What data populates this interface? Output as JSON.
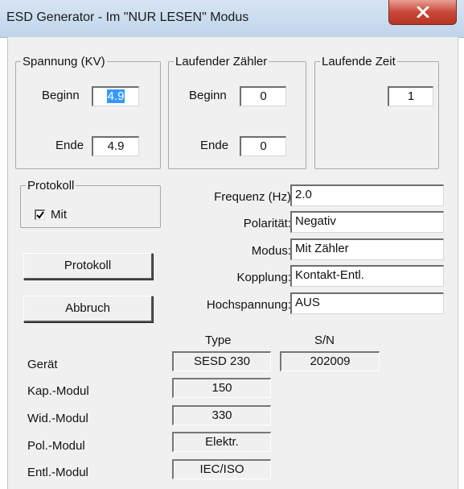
{
  "window": {
    "title": "ESD Generator - Im \"NUR LESEN\" Modus"
  },
  "spannung": {
    "legend": "Spannung (KV)",
    "beginn_label": "Beginn",
    "beginn_value": "4.9",
    "ende_label": "Ende",
    "ende_value": "4.9"
  },
  "zaehler": {
    "legend": "Laufender Zähler",
    "beginn_label": "Beginn",
    "beginn_value": "0",
    "ende_label": "Ende",
    "ende_value": "0"
  },
  "zeit": {
    "legend": "Laufende Zeit",
    "value": "1"
  },
  "protokoll": {
    "legend": "Protokoll",
    "checkbox_label": "Mit",
    "checked": true
  },
  "settings": [
    {
      "label": "Frequenz (Hz)",
      "value": "2.0"
    },
    {
      "label": "Polarität:",
      "value": "Negativ"
    },
    {
      "label": "Modus:",
      "value": "Mit Zähler"
    },
    {
      "label": "Kopplung:",
      "value": "Kontakt-Entl."
    },
    {
      "label": "Hochspannung:",
      "value": "AUS"
    }
  ],
  "buttons": {
    "protokoll": "Protokoll",
    "abbruch": "Abbruch"
  },
  "table": {
    "col_type": "Type",
    "col_sn": "S/N",
    "rows": [
      {
        "label": "Gerät",
        "type": "SESD 230",
        "sn": "202009"
      },
      {
        "label": "Kap.-Modul",
        "type": "150"
      },
      {
        "label": "Wid.-Modul",
        "type": "330"
      },
      {
        "label": "Pol.-Modul",
        "type": "Elektr."
      },
      {
        "label": "Entl.-Modul",
        "type": "IEC/ISO"
      }
    ]
  }
}
